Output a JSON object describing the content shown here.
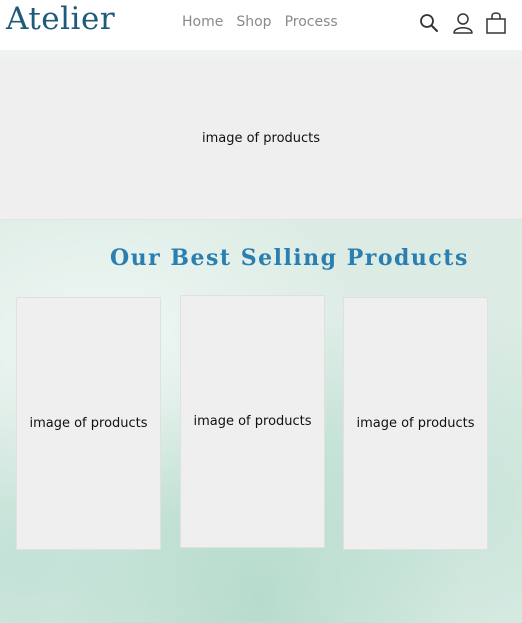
{
  "header": {
    "logo": "Atelier",
    "nav": [
      {
        "label": "Home"
      },
      {
        "label": "Shop"
      },
      {
        "label": "Process"
      }
    ],
    "icons": {
      "search": "search-icon",
      "account": "user-icon",
      "cart": "shopping-bag-icon"
    }
  },
  "hero": {
    "placeholder": "image of products"
  },
  "best_sellers": {
    "title": "Our Best Selling Products",
    "products": [
      {
        "placeholder": "image of products"
      },
      {
        "placeholder": "image of products"
      },
      {
        "placeholder": "image of products"
      }
    ]
  },
  "colors": {
    "brand": "#1e5a7a",
    "section_title": "#2a7fb0",
    "nav_text": "#8a8a8a",
    "section_bg": "#dcece5"
  }
}
